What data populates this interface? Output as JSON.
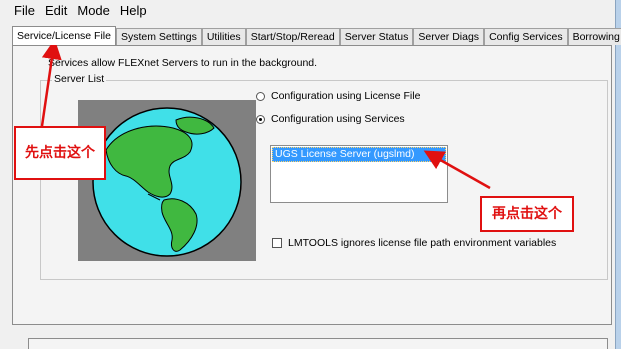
{
  "menu": [
    "File",
    "Edit",
    "Mode",
    "Help"
  ],
  "tabs": [
    {
      "label": "Service/License File",
      "active": true
    },
    {
      "label": "System Settings",
      "active": false
    },
    {
      "label": "Utilities",
      "active": false
    },
    {
      "label": "Start/Stop/Reread",
      "active": false
    },
    {
      "label": "Server Status",
      "active": false
    },
    {
      "label": "Server Diags",
      "active": false
    },
    {
      "label": "Config Services",
      "active": false
    },
    {
      "label": "Borrowing",
      "active": false
    }
  ],
  "panel": {
    "description": "Services allow FLEXnet Servers to run in the background.",
    "group_title": "Server List",
    "radio_license_file": "Configuration using License File",
    "radio_services": "Configuration using Services",
    "selected_radio": "services",
    "service_list": [
      "UGS License Server (ugslmd)"
    ],
    "checkbox_label": "LMTOOLS ignores license file path environment variables",
    "checkbox_checked": false
  },
  "annotations": {
    "first_click": "先点击这个",
    "second_click": "再点击这个",
    "color": "#e01010"
  },
  "colors": {
    "selection": "#3399ff",
    "globe_ocean": "#40e0e8",
    "globe_land": "#40b840",
    "globe_frame": "#808080"
  }
}
